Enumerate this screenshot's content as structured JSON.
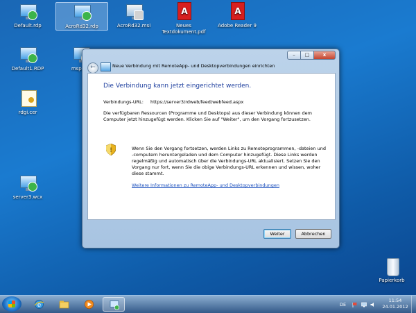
{
  "desktop": {
    "icons": [
      {
        "label": "Default.rdp",
        "selected": false
      },
      {
        "label": "AcroRd32.rdp",
        "selected": true
      },
      {
        "label": "AcroRd32.msi",
        "selected": false
      },
      {
        "label": "Neues Textdokument.pdf",
        "selected": false
      },
      {
        "label": "Adobe Reader 9",
        "selected": false
      },
      {
        "label": "Default1.RDP",
        "selected": false
      },
      {
        "label": "mspaint",
        "selected": false
      },
      {
        "label": "rdgi.cer",
        "selected": false
      },
      {
        "label": "server3.wcx",
        "selected": false
      },
      {
        "label": "Papierkorb",
        "selected": false
      }
    ]
  },
  "dialog": {
    "title": "Neue Verbindung mit RemoteApp- und Desktopverbindungen einrichten",
    "heading": "Die Verbindung kann jetzt eingerichtet werden.",
    "url_label": "Verbindungs-URL:",
    "url_value": "https://server3/rdweb/feed/webfeed.aspx",
    "description": "Die verfügbaren Ressourcen (Programme und Desktops) aus dieser Verbindung können dem Computer jetzt hinzugefügt werden. Klicken Sie auf \"Weiter\", um den Vorgang fortzusetzen.",
    "warning": "Wenn Sie den Vorgang fortsetzen, werden Links zu Remoteprogrammen, -dateien und -computern heruntergeladen und dem Computer hinzugefügt. Diese Links werden regelmäßig und automatisch über die Verbindungs-URL aktualisiert. Setzen Sie den Vorgang nur fort, wenn Sie die obige Verbindungs-URL erkennen und wissen, woher diese stammt.",
    "link": "Weitere Informationen zu RemoteApp- und Desktopverbindungen",
    "next_label": "Weiter",
    "cancel_label": "Abbrechen",
    "back_glyph": "←",
    "minimize_glyph": "–",
    "maximize_glyph": "□",
    "close_glyph": "x"
  },
  "taskbar": {
    "language": "DE",
    "time": "11:54",
    "date": "24.01.2012",
    "pinned": [
      "start-button",
      "internet-explorer-icon",
      "explorer-folder-icon",
      "media-player-icon",
      "remoteapp-wizard-icon"
    ]
  },
  "colors": {
    "heading": "#1e3f9e",
    "link": "#1a4fbd",
    "desktop_blue": "#1a7bd0"
  }
}
